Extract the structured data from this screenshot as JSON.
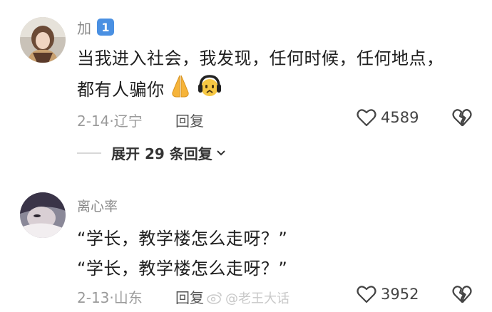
{
  "comments": [
    {
      "username": "加",
      "badge": "1",
      "lines": [
        "当我进入社会，我发现，任何时候，任何地点，",
        "都有人骗你"
      ],
      "date": "2-14",
      "location": "辽宁",
      "reply_label": "回复",
      "likes": "4589",
      "icons": [
        "praying-hands-emoji",
        "headphone-face-emoji"
      ]
    },
    {
      "username": "离心率",
      "lines": [
        "“学长，教学楼怎么走呀？”",
        "“学长，教学楼怎么走呀？”"
      ],
      "date": "2-13",
      "location": "山东",
      "reply_label": "回复",
      "likes": "3952"
    }
  ],
  "expand": {
    "label": "展开 29 条回复"
  },
  "watermark": "@老王大话",
  "colors": {
    "badge": "#4a90e2",
    "meta_text": "#9a9a9a"
  }
}
